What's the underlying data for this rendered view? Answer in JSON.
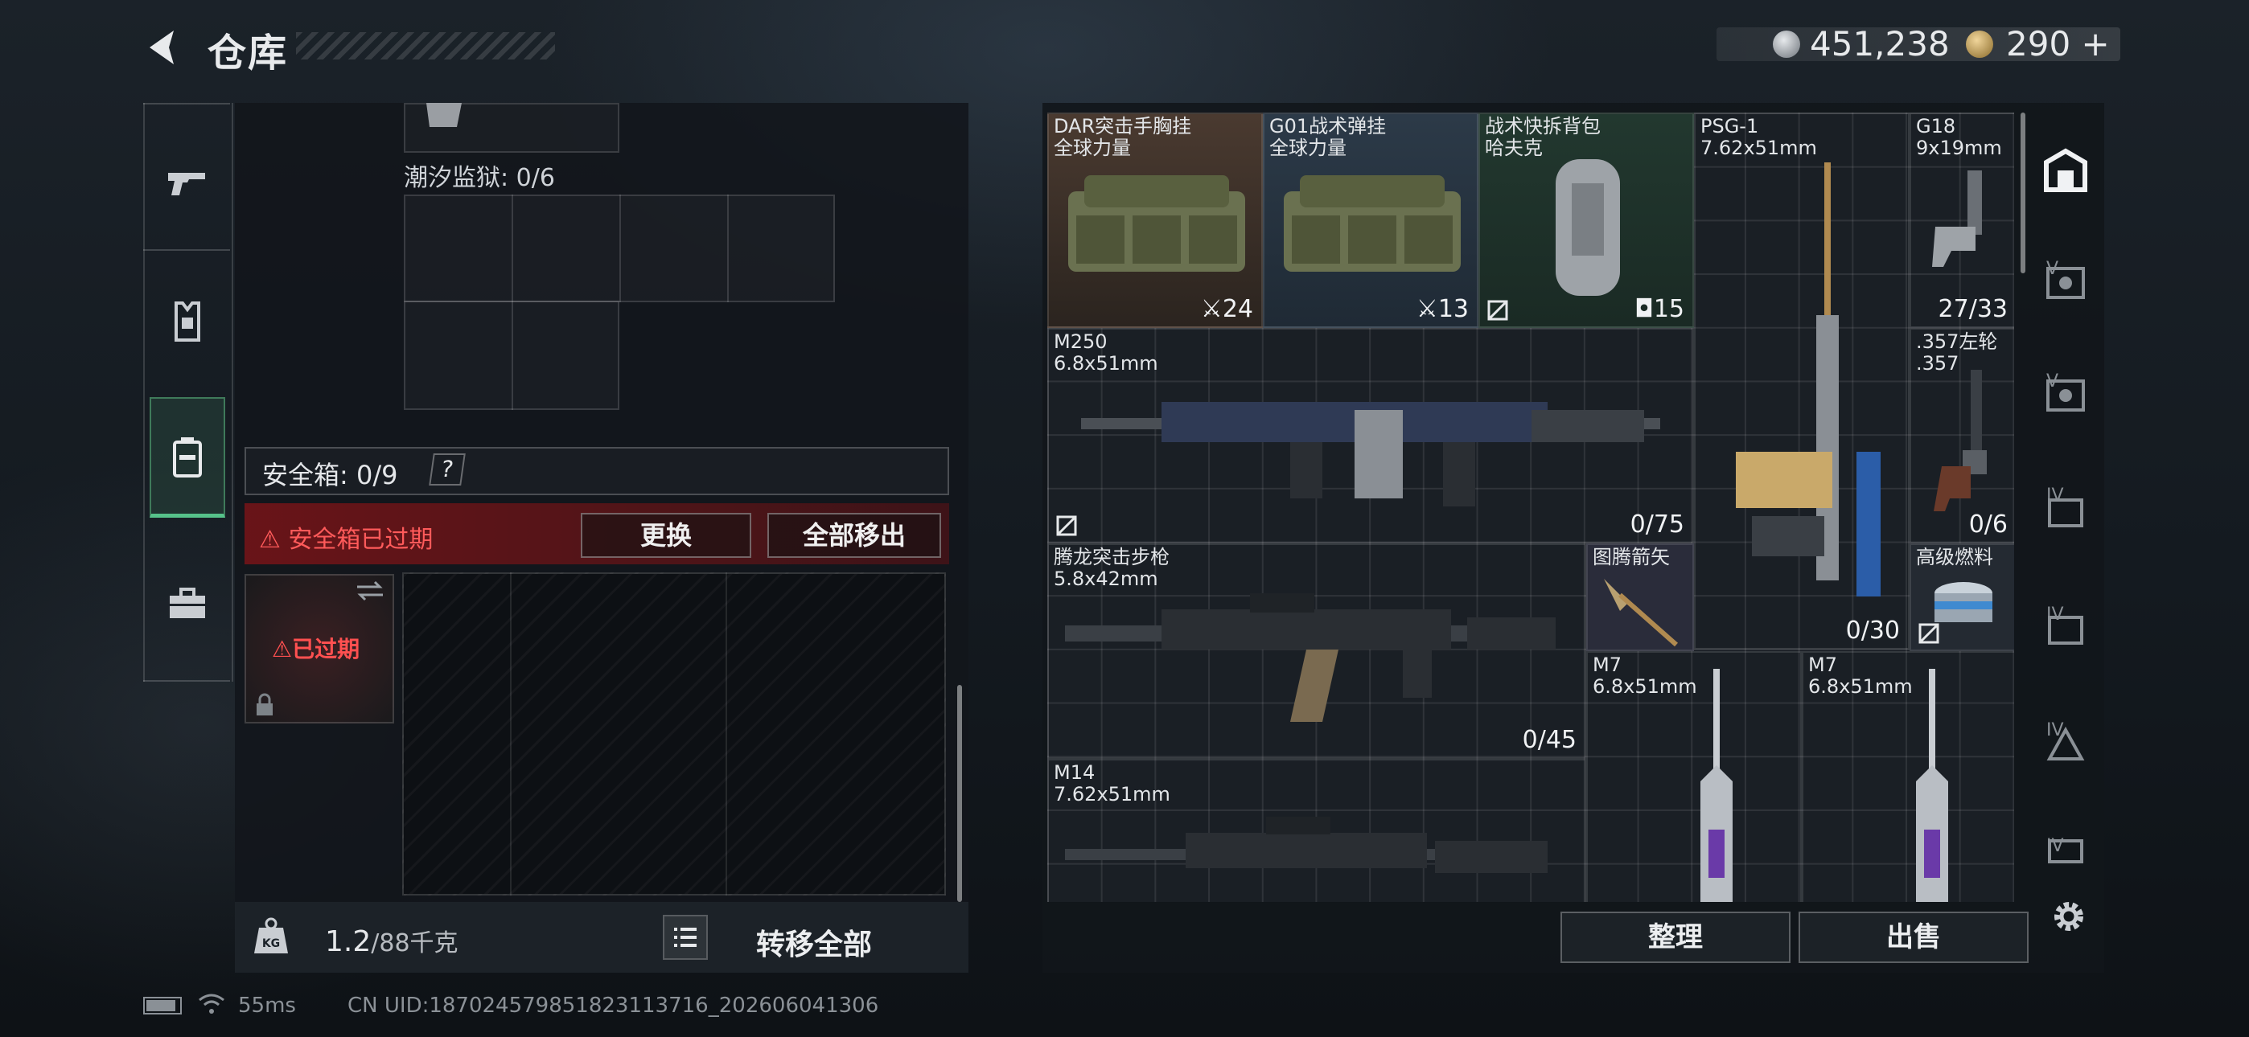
{
  "header": {
    "title": "仓库"
  },
  "currency": {
    "silver": "451,238",
    "gold": "290",
    "gold_plus": "+"
  },
  "left_panel": {
    "prison_label": "潮汐监狱: 0/6",
    "safebox_label": "安全箱: 0/9",
    "help_mark": "?",
    "expired_warning": "安全箱已过期",
    "replace_button": "更换",
    "remove_all_button": "全部移出",
    "safe_item_status": "已过期",
    "weight_value": "1.2",
    "weight_max": "/88千克",
    "transfer_all_button": "转移全部"
  },
  "items": [
    {
      "name1": "DAR突击手胸挂",
      "name2": "全球力量",
      "count": "24"
    },
    {
      "name1": "G01战术弹挂",
      "name2": "全球力量",
      "count": "13"
    },
    {
      "name1": "战术快拆背包",
      "name2": "哈夫克",
      "count": "15"
    },
    {
      "name1": "PSG-1",
      "name2": "7.62x51mm",
      "count": "0/30"
    },
    {
      "name1": "G18",
      "name2": "9x19mm",
      "count": "27/33"
    },
    {
      "name1": "M250",
      "name2": "6.8x51mm",
      "count": "0/75"
    },
    {
      "name1": ".357左轮",
      "name2": ".357",
      "count": "0/6"
    },
    {
      "name1": "腾龙突击步枪",
      "name2": "5.8x42mm",
      "count": "0/45"
    },
    {
      "name1": "图腾箭矢",
      "name2": "",
      "count": ""
    },
    {
      "name1": "高级燃料",
      "name2": "",
      "count": ""
    },
    {
      "name1": "M7",
      "name2": "6.8x51mm",
      "count": ""
    },
    {
      "name1": "M7",
      "name2": "6.8x51mm",
      "count": ""
    },
    {
      "name1": "M14",
      "name2": "7.62x51mm",
      "count": ""
    }
  ],
  "side_tabs": [
    "V",
    "V",
    "IV",
    "IV",
    "IV",
    "IV"
  ],
  "actions": {
    "sort": "整理",
    "sell": "出售"
  },
  "status_bar": {
    "ping": "55ms",
    "uid": "CN UID:18702457985182311371​6_202606041306"
  },
  "colors": {
    "accent_green": "#56c28a",
    "warning_red": "#ff5a5a",
    "bg": "#11161c"
  }
}
